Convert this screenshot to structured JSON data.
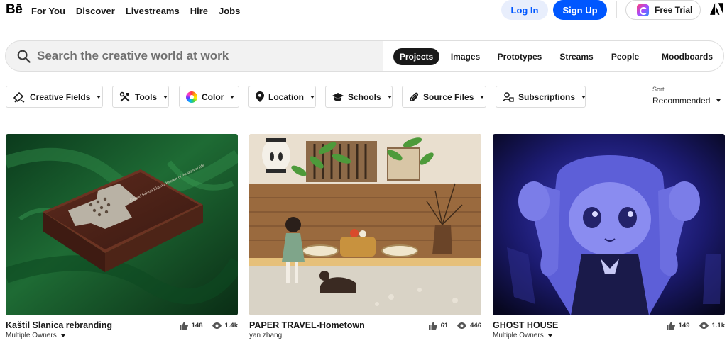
{
  "header": {
    "logo": "Bē",
    "nav": [
      "For You",
      "Discover",
      "Livestreams",
      "Hire",
      "Jobs"
    ],
    "login_label": "Log In",
    "signup_label": "Sign Up",
    "trial_label": "Free Trial"
  },
  "search": {
    "placeholder": "Search the creative world at work",
    "tabs": [
      "Projects",
      "Images",
      "Prototypes",
      "Streams",
      "People",
      "Moodboards"
    ],
    "active_tab": "Projects"
  },
  "filters": [
    "Creative Fields",
    "Tools",
    "Color",
    "Location",
    "Schools",
    "Source Files",
    "Subscriptions"
  ],
  "sort": {
    "label": "Sort",
    "value": "Recommended"
  },
  "projects": [
    {
      "title": "Kaštil Slanica rebranding",
      "owner": "Multiple Owners",
      "likes": "148",
      "views": "1.4k",
      "box_text": "Čovaarí Salvina Klanska Keepers of the spirit of life"
    },
    {
      "title": "PAPER TRAVEL-Hometown",
      "owner": "yan zhang",
      "likes": "61",
      "views": "446"
    },
    {
      "title": "GHOST HOUSE",
      "owner": "Multiple Owners",
      "likes": "149",
      "views": "1.1k"
    }
  ],
  "colors": {
    "accent": "#0057ff",
    "login_bg": "#e8eefc",
    "text": "#191919",
    "active_tab_bg": "#191919"
  }
}
